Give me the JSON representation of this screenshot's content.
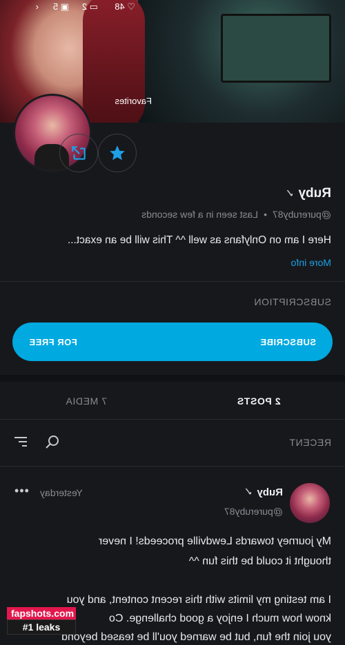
{
  "status": {
    "likes": "48",
    "photos": "5",
    "videos": "2"
  },
  "header": {
    "favorites_label": "Favorites"
  },
  "profile": {
    "name": "Ruby",
    "handle": "@pureruby87",
    "last_seen": "Last seen in a few seconds",
    "separator": "•",
    "bio": "Here I am on Onlyfans as well ^^ This will be an exact...",
    "more_info": "More info"
  },
  "subscription": {
    "title": "SUBSCRIPTION",
    "subscribe_label": "SUBSCRIBE",
    "price_label": "FOR FREE"
  },
  "tabs": [
    {
      "label": "2 POSTS",
      "active": true
    },
    {
      "label": "7 MEDIA",
      "active": false
    }
  ],
  "feed": {
    "title": "RECENT"
  },
  "post": {
    "name": "Ruby",
    "handle": "@pureruby87",
    "time": "Yesterday",
    "more": "•••",
    "lines": [
      "My journey towards Lewdville proceeds! I never",
      "thought it could be this fun ^^",
      "",
      "I am testing my limits with this recent content, and you",
      "know how much I enjoy a good challenge. Co",
      "you join the fun, but be warned you'll be teased beyond"
    ]
  },
  "watermark": {
    "site": "fapshots.com",
    "tagline": "#1 leaks"
  },
  "colors": {
    "accent": "#00a9e0",
    "background": "#17181c",
    "link": "#1ea0e6"
  }
}
